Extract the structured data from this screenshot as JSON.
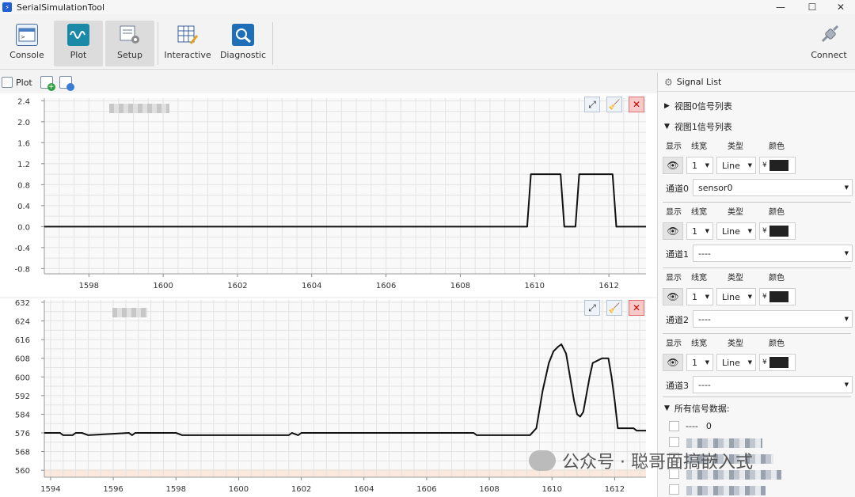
{
  "window": {
    "title": "SerialSimulationTool"
  },
  "toolbar": {
    "console": "Console",
    "plot": "Plot",
    "setup": "Setup",
    "interactive": "Interactive",
    "diagnostic": "Diagnostic",
    "connect": "Connect"
  },
  "plot_tab": {
    "label": "Plot"
  },
  "charts": [
    {
      "y_ticks": [
        "2.4",
        "2.0",
        "1.6",
        "1.2",
        "0.8",
        "0.4",
        "0.0",
        "-0.4",
        "-0.8"
      ],
      "x_ticks": [
        "1598",
        "1600",
        "1602",
        "1604",
        "1606",
        "1608",
        "1610",
        "1612"
      ]
    },
    {
      "y_ticks": [
        "632",
        "624",
        "616",
        "608",
        "600",
        "592",
        "584",
        "576",
        "568",
        "560"
      ],
      "x_ticks": [
        "1594",
        "1596",
        "1598",
        "1600",
        "1602",
        "1604",
        "1606",
        "1608",
        "1610",
        "1612"
      ]
    }
  ],
  "chart_data": [
    {
      "type": "line",
      "ylim": [
        -0.9,
        2.45
      ],
      "xlim": [
        1596.8,
        1613
      ],
      "x": [
        1596.8,
        1609.8,
        1609.9,
        1610.7,
        1610.8,
        1611.1,
        1611.2,
        1612.1,
        1612.2,
        1613
      ],
      "y": [
        0,
        0,
        1,
        1,
        0,
        0,
        1,
        1,
        0,
        0
      ]
    },
    {
      "type": "line",
      "ylim": [
        557,
        633
      ],
      "xlim": [
        1593.8,
        1613
      ],
      "x": [
        1593.8,
        1594.3,
        1594.4,
        1594.7,
        1594.8,
        1595.0,
        1595.2,
        1596.5,
        1596.6,
        1596.7,
        1598.0,
        1598.2,
        1601.6,
        1601.7,
        1601.9,
        1602.0,
        1607.5,
        1607.6,
        1609.3,
        1609.5,
        1609.7,
        1609.9,
        1610.05,
        1610.2,
        1610.3,
        1610.45,
        1610.7,
        1610.8,
        1610.9,
        1611.0,
        1611.2,
        1611.3,
        1611.6,
        1611.8,
        1611.9,
        1612.0,
        1612.1,
        1612.6,
        1612.7,
        1613
      ],
      "y": [
        576,
        576,
        575,
        575,
        576,
        576,
        575,
        576,
        575,
        576,
        576,
        575,
        575,
        576,
        575,
        576,
        576,
        575,
        575,
        578,
        594,
        606,
        611,
        613,
        614,
        610,
        590,
        584,
        583,
        585,
        600,
        606,
        608,
        608,
        600,
        590,
        578,
        578,
        577,
        577
      ]
    }
  ],
  "panel": {
    "title": "Signal List",
    "view0": "视图0信号列表",
    "view1": "视图1信号列表",
    "headers": {
      "show": "显示",
      "width": "线宽",
      "type": "类型",
      "color": "颜色"
    },
    "channels": [
      {
        "label": "通道0",
        "width": "1",
        "type": "Line",
        "source": "sensor0"
      },
      {
        "label": "通道1",
        "width": "1",
        "type": "Line",
        "source": "----"
      },
      {
        "label": "通道2",
        "width": "1",
        "type": "Line",
        "source": "----"
      },
      {
        "label": "通道3",
        "width": "1",
        "type": "Line",
        "source": "----"
      }
    ],
    "all_signals": "所有信号数据:",
    "signal_entries": [
      {
        "name": "----",
        "value": "0"
      }
    ]
  },
  "watermark": "公众号 · 聪哥面搞嵌入式",
  "colors": {
    "accent": "#1f5fd6",
    "plot_line": "#111111",
    "grid": "#e3e3e3",
    "swatch": "#222222"
  }
}
